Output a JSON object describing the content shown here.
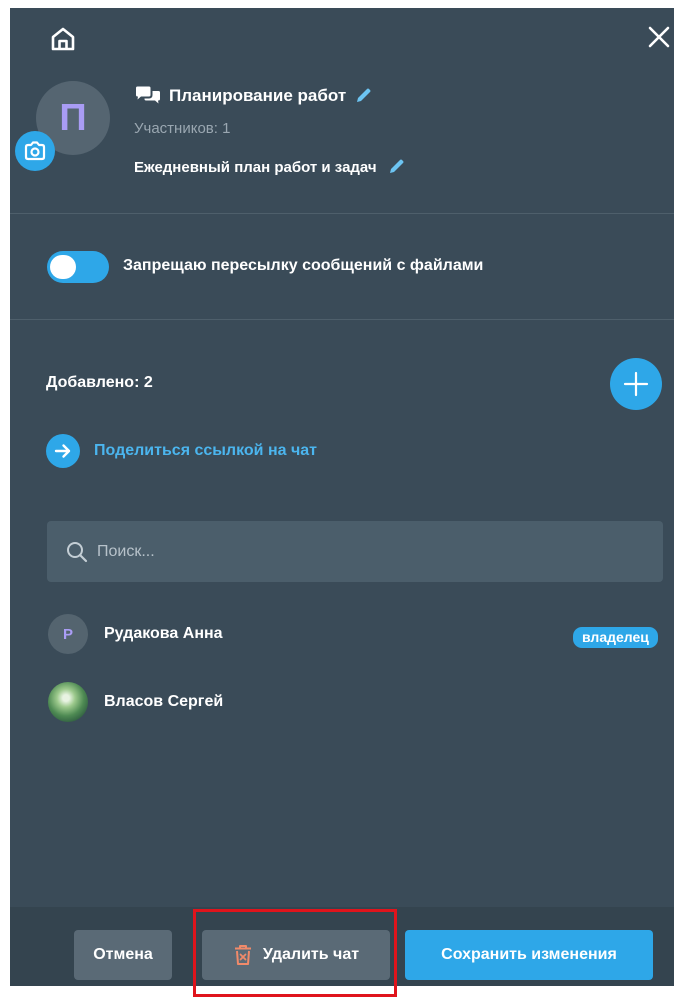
{
  "chat": {
    "avatar_letter": "П",
    "title": "Планирование работ",
    "members_count_text": "Участников: 1",
    "description": "Ежедневный план работ и задач"
  },
  "settings": {
    "forward_restriction_label": "Запрещаю пересылку сообщений с файлами",
    "forward_restriction_enabled": true
  },
  "members_section": {
    "added_label": "Добавлено: 2",
    "share_link_label": "Поделиться ссылкой на чат",
    "search_placeholder": "Поиск..."
  },
  "members": [
    {
      "name": "Рудакова Анна",
      "avatar_letter": "Р",
      "badge": "владелец"
    },
    {
      "name": "Власов Сергей",
      "avatar": "photo"
    }
  ],
  "footer": {
    "cancel_label": "Отмена",
    "delete_label": "Удалить чат",
    "save_label": "Сохранить изменения"
  },
  "colors": {
    "panel_bg": "#3a4b58",
    "accent": "#2ea7e8",
    "avatar_letter_color": "#a99cf4",
    "delete_icon": "#f08a6a",
    "highlight": "#e0141c"
  },
  "icons": [
    "home-icon",
    "close-icon",
    "camera-icon",
    "chat-bubbles-icon",
    "pencil-icon",
    "plus-icon",
    "arrow-right-icon",
    "search-icon",
    "trash-icon"
  ]
}
